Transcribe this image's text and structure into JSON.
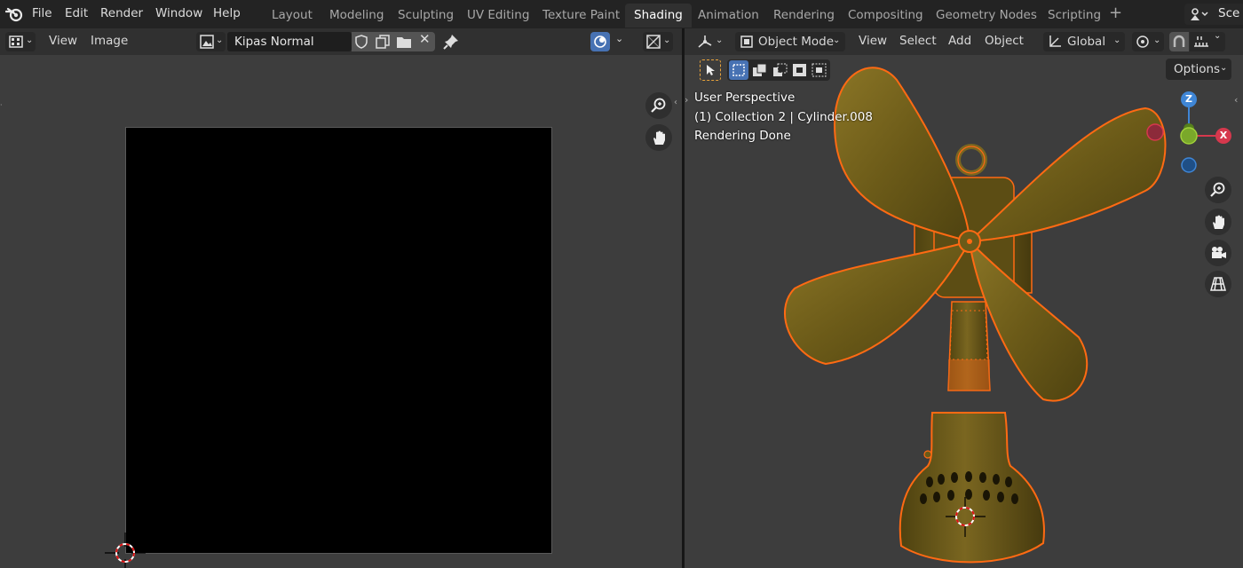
{
  "menu": {
    "file": "File",
    "edit": "Edit",
    "render": "Render",
    "window": "Window",
    "help": "Help"
  },
  "workspaces": [
    {
      "label": "Layout"
    },
    {
      "label": "Modeling"
    },
    {
      "label": "Sculpting"
    },
    {
      "label": "UV Editing"
    },
    {
      "label": "Texture Paint"
    },
    {
      "label": "Shading"
    },
    {
      "label": "Animation"
    },
    {
      "label": "Rendering"
    },
    {
      "label": "Compositing"
    },
    {
      "label": "Geometry Nodes"
    },
    {
      "label": "Scripting"
    }
  ],
  "active_workspace": "Shading",
  "scene_label": "Sce",
  "image_editor": {
    "view_menu": "View",
    "image_menu": "Image",
    "image_name": "Kipas Normal"
  },
  "viewport": {
    "mode": "Object Mode",
    "view_menu": "View",
    "select_menu": "Select",
    "add_menu": "Add",
    "object_menu": "Object",
    "orientation": "Global",
    "options": "Options",
    "perspective": "User Perspective",
    "collection_info": "(1) Collection 2 | Cylinder.008",
    "render_status": "Rendering Done",
    "gizmo": {
      "z": "Z",
      "x": "X"
    }
  },
  "colors": {
    "accent": "#4772b3",
    "selection_outline": "#ff6a13",
    "model": "#6e5c18"
  }
}
